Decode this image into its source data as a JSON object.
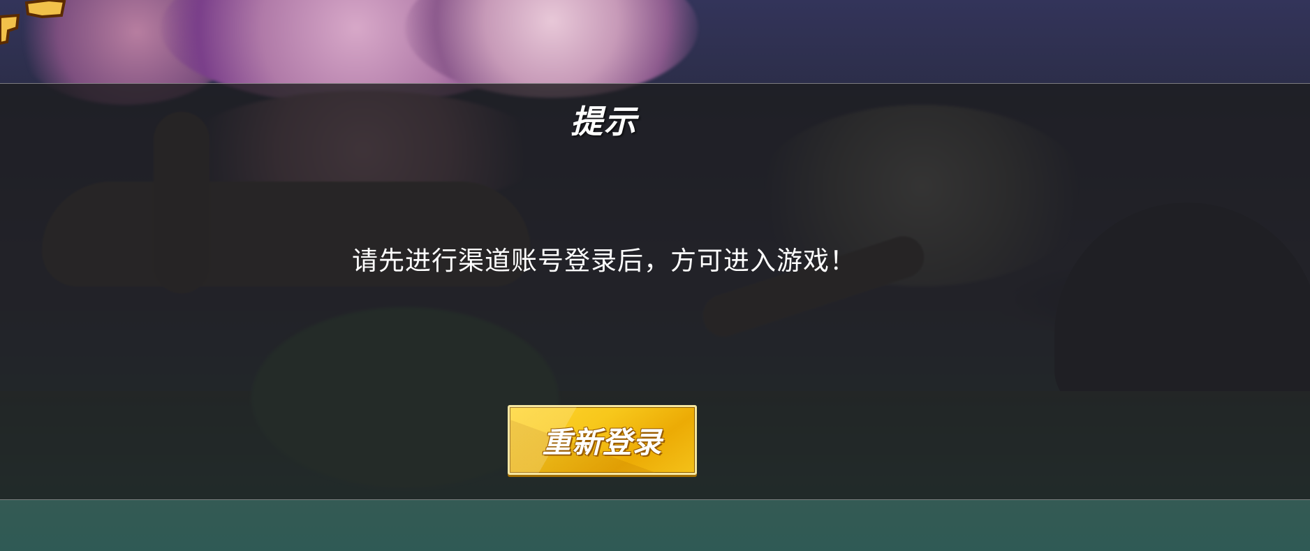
{
  "dialog": {
    "title": "提示",
    "message": "请先进行渠道账号登录后，方可进入游戏！",
    "button_label": "重新登录"
  },
  "colors": {
    "button_fill": "#f7c71b",
    "button_border": "#f6e7a1",
    "overlay": "#1c1c1e",
    "text": "#ffffff"
  }
}
